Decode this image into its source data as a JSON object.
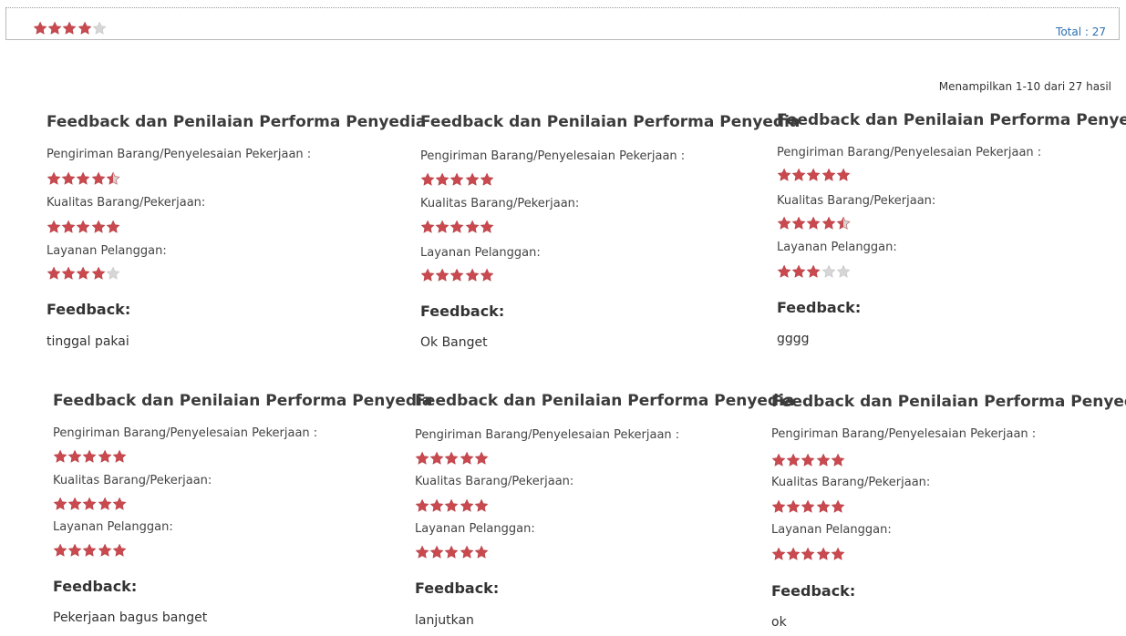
{
  "summary": {
    "rating": 4,
    "total_text": "Total : 27"
  },
  "result_summary": "Menampilkan 1-10 dari 27 hasil",
  "colors": {
    "star_filled": "#c9494f",
    "star_empty": "#d6d6d6",
    "link": "#2a6fae"
  },
  "cards": [
    {
      "title": "Feedback dan Penilaian Performa Penyedia",
      "criteria": [
        {
          "label": "Pengiriman Barang/Penyelesaian Pekerjaan :",
          "rating": 4.5
        },
        {
          "label": "Kualitas Barang/Pekerjaan:",
          "rating": 5
        },
        {
          "label": "Layanan Pelanggan:",
          "rating": 4
        }
      ],
      "feedback_label": "Feedback:",
      "feedback_text": "tinggal pakai"
    },
    {
      "title": "Feedback dan Penilaian Performa Penyedia",
      "criteria": [
        {
          "label": "Pengiriman Barang/Penyelesaian Pekerjaan :",
          "rating": 5
        },
        {
          "label": "Kualitas Barang/Pekerjaan:",
          "rating": 5
        },
        {
          "label": "Layanan Pelanggan:",
          "rating": 5
        }
      ],
      "feedback_label": "Feedback:",
      "feedback_text": "Ok Banget"
    },
    {
      "title": "Feedback dan Penilaian Performa Penyedia",
      "criteria": [
        {
          "label": "Pengiriman Barang/Penyelesaian Pekerjaan :",
          "rating": 5
        },
        {
          "label": "Kualitas Barang/Pekerjaan:",
          "rating": 4.5
        },
        {
          "label": "Layanan Pelanggan:",
          "rating": 3
        }
      ],
      "feedback_label": "Feedback:",
      "feedback_text": "gggg"
    },
    {
      "title": "Feedback dan Penilaian Performa Penyedia",
      "criteria": [
        {
          "label": "Pengiriman Barang/Penyelesaian Pekerjaan :",
          "rating": 5
        },
        {
          "label": "Kualitas Barang/Pekerjaan:",
          "rating": 5
        },
        {
          "label": "Layanan Pelanggan:",
          "rating": 5
        }
      ],
      "feedback_label": "Feedback:",
      "feedback_text": "Pekerjaan bagus banget"
    },
    {
      "title": "Feedback dan Penilaian Performa Penyedia",
      "criteria": [
        {
          "label": "Pengiriman Barang/Penyelesaian Pekerjaan :",
          "rating": 5
        },
        {
          "label": "Kualitas Barang/Pekerjaan:",
          "rating": 5
        },
        {
          "label": "Layanan Pelanggan:",
          "rating": 5
        }
      ],
      "feedback_label": "Feedback:",
      "feedback_text": "lanjutkan"
    },
    {
      "title": "Feedback dan Penilaian Performa Penyedia",
      "criteria": [
        {
          "label": "Pengiriman Barang/Penyelesaian Pekerjaan :",
          "rating": 5
        },
        {
          "label": "Kualitas Barang/Pekerjaan:",
          "rating": 5
        },
        {
          "label": "Layanan Pelanggan:",
          "rating": 5
        }
      ],
      "feedback_label": "Feedback:",
      "feedback_text": "ok"
    }
  ]
}
